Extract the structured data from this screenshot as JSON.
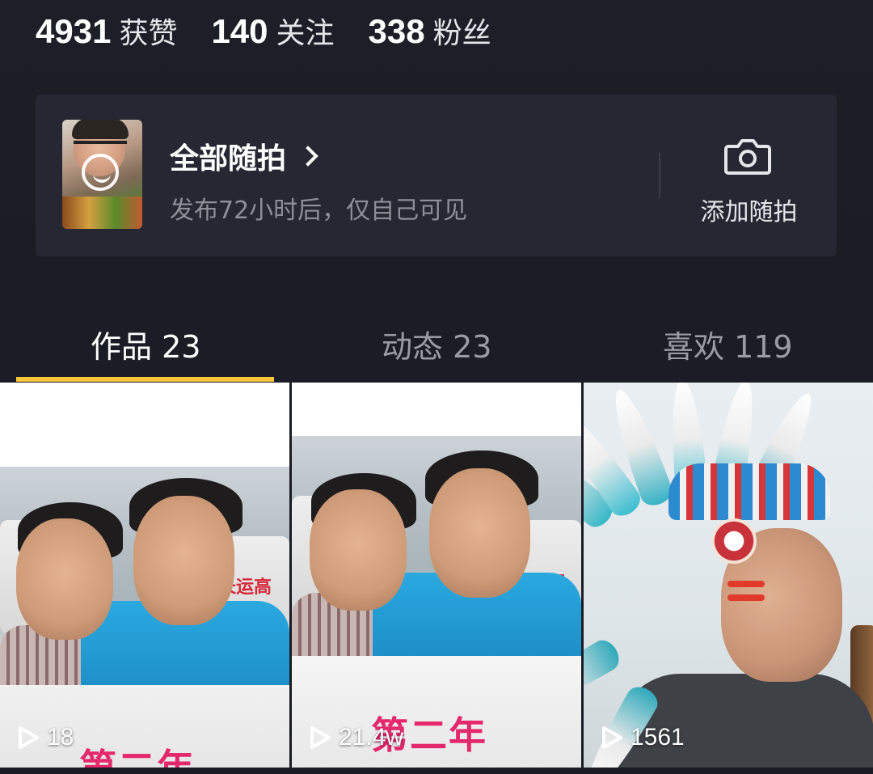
{
  "stats": [
    {
      "num": "4931",
      "label": "获赞"
    },
    {
      "num": "140",
      "label": "关注"
    },
    {
      "num": "338",
      "label": "粉丝"
    }
  ],
  "quickshot": {
    "title": "全部随拍",
    "subtitle": "发布72小时后，仅自己可见",
    "add_label": "添加随拍",
    "icons": {
      "camera": "camera-icon",
      "chevron": "chevron-right-icon"
    }
  },
  "tabs": [
    {
      "label": "作品 23",
      "active": true
    },
    {
      "label": "动态 23",
      "active": false
    },
    {
      "label": "喜欢 119",
      "active": false
    }
  ],
  "accent_color": "#f8c73a",
  "videos": [
    {
      "views": "18",
      "caption": "第二年"
    },
    {
      "views": "21.4w",
      "caption": "第二年"
    },
    {
      "views": "1561",
      "caption": ""
    }
  ]
}
